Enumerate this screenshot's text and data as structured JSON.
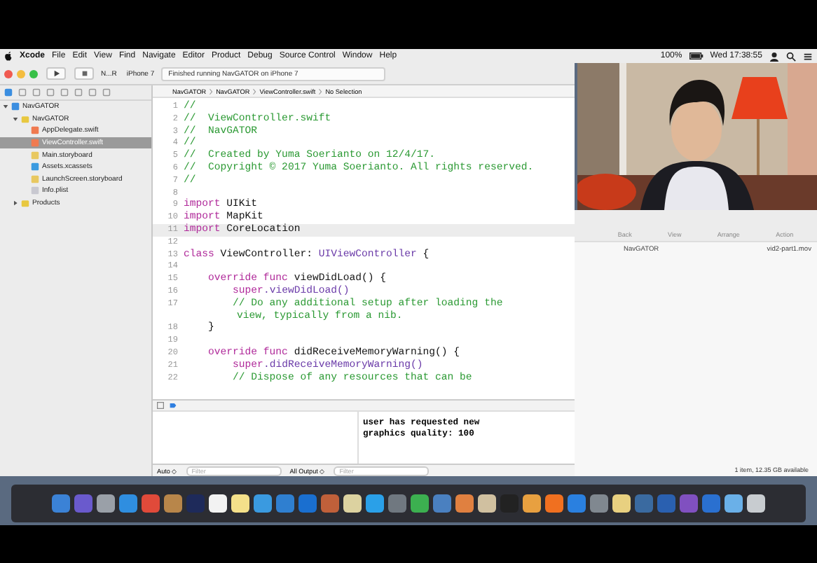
{
  "menu_bar": {
    "menus": [
      "Xcode",
      "File",
      "Edit",
      "View",
      "Find",
      "Navigate",
      "Editor",
      "Product",
      "Debug",
      "Source Control",
      "Window",
      "Help"
    ],
    "battery": "100%",
    "clock": "Wed 17:38:55"
  },
  "xcode": {
    "toolbar": {
      "scheme": "N...R",
      "device": "iPhone 7",
      "status": "Finished running NavGATOR on iPhone 7"
    },
    "navigator": [
      {
        "label": "NavGATOR",
        "kind": "project",
        "expanded": true,
        "selected": false,
        "children": [
          {
            "label": "NavGATOR",
            "kind": "folder",
            "expanded": true,
            "selected": false,
            "children": [
              {
                "label": "AppDelegate.swift",
                "kind": "swift",
                "selected": false
              },
              {
                "label": "ViewController.swift",
                "kind": "swift",
                "selected": true
              },
              {
                "label": "Main.storyboard",
                "kind": "storyboard",
                "selected": false
              },
              {
                "label": "Assets.xcassets",
                "kind": "assets",
                "selected": false
              },
              {
                "label": "LaunchScreen.storyboard",
                "kind": "storyboard",
                "selected": false
              },
              {
                "label": "Info.plist",
                "kind": "plist",
                "selected": false
              }
            ]
          },
          {
            "label": "Products",
            "kind": "folder",
            "expanded": false,
            "selected": false
          }
        ]
      }
    ],
    "jump_bar": [
      "NavGATOR",
      "NavGATOR",
      "ViewController.swift",
      "No Selection"
    ],
    "code": [
      {
        "number": "1",
        "current": false,
        "segments": [
          {
            "kind": "comment",
            "text": "//"
          }
        ]
      },
      {
        "number": "2",
        "current": false,
        "segments": [
          {
            "kind": "comment",
            "text": "//  ViewController.swift"
          }
        ]
      },
      {
        "number": "3",
        "current": false,
        "segments": [
          {
            "kind": "comment",
            "text": "//  NavGATOR"
          }
        ]
      },
      {
        "number": "4",
        "current": false,
        "segments": [
          {
            "kind": "comment",
            "text": "//"
          }
        ]
      },
      {
        "number": "5",
        "current": false,
        "segments": [
          {
            "kind": "comment",
            "text": "//  Created by Yuma Soerianto on 12/4/17."
          }
        ]
      },
      {
        "number": "6",
        "current": false,
        "segments": [
          {
            "kind": "comment",
            "text": "//  Copyright © 2017 Yuma Soerianto. All rights reserved."
          }
        ]
      },
      {
        "number": "7",
        "current": false,
        "segments": [
          {
            "kind": "comment",
            "text": "//"
          }
        ]
      },
      {
        "number": "8",
        "current": false
      },
      {
        "number": "9",
        "current": false,
        "segments": [
          {
            "kind": "keyword",
            "text": "import"
          },
          {
            "kind": "plain",
            "text": " UIKit"
          }
        ]
      },
      {
        "number": "10",
        "current": false,
        "segments": [
          {
            "kind": "keyword",
            "text": "import"
          },
          {
            "kind": "plain",
            "text": " MapKit"
          }
        ]
      },
      {
        "number": "11",
        "current": true,
        "segments": [
          {
            "kind": "keyword",
            "text": "import"
          },
          {
            "kind": "plain",
            "text": " CoreLocation"
          }
        ]
      },
      {
        "number": "12",
        "current": false
      },
      {
        "number": "13",
        "current": false,
        "segments": [
          {
            "kind": "keyword",
            "text": "class"
          },
          {
            "kind": "plain",
            "text": " ViewController: "
          },
          {
            "kind": "type",
            "text": "UIViewController"
          },
          {
            "kind": "plain",
            "text": " {"
          }
        ]
      },
      {
        "number": "14",
        "current": false
      },
      {
        "number": "15",
        "current": false,
        "segments": [
          {
            "kind": "keyword",
            "text": "    override func"
          },
          {
            "kind": "plain",
            "text": " viewDidLoad() {"
          }
        ]
      },
      {
        "number": "16",
        "current": false,
        "segments": [
          {
            "kind": "keyword",
            "text": "        super"
          },
          {
            "kind": "type",
            "text": ".viewDidLoad()"
          }
        ]
      },
      {
        "number": "17",
        "current": false,
        "segments": [
          {
            "kind": "comment",
            "text": "        // Do any additional setup after loading the"
          }
        ],
        "continuation": "view, typically from a nib."
      },
      {
        "number": "18",
        "current": false,
        "segments": [
          {
            "kind": "plain",
            "text": "    }"
          }
        ]
      },
      {
        "number": "19",
        "current": false
      },
      {
        "number": "20",
        "current": false,
        "segments": [
          {
            "kind": "keyword",
            "text": "    override func"
          },
          {
            "kind": "plain",
            "text": " didReceiveMemoryWarning() {"
          }
        ]
      },
      {
        "number": "21",
        "current": false,
        "segments": [
          {
            "kind": "keyword",
            "text": "        super"
          },
          {
            "kind": "type",
            "text": ".didReceiveMemoryWarning()"
          }
        ]
      },
      {
        "number": "22",
        "current": false,
        "segments": [
          {
            "kind": "comment",
            "text": "        // Dispose of any resources that can be"
          }
        ]
      }
    ],
    "console": [
      "user has requested new",
      "graphics quality: 100"
    ],
    "debug_bar": {
      "variables_scope": "Auto ◇",
      "variables_filter": "Filter",
      "output_scope": "All Output ◇",
      "output_filter": "Filter"
    }
  },
  "finder": {
    "toolbar": [
      "Back",
      "View",
      "Arrange",
      "Action"
    ],
    "path": "NavGATOR",
    "file": "vid2-part1.mov",
    "status": "1 item, 12.35 GB available"
  },
  "dock": [
    {
      "color": "#3b82d6"
    },
    {
      "color": "#6a5acd"
    },
    {
      "color": "#9aa0a8"
    },
    {
      "color": "#2f8ee0"
    },
    {
      "color": "#e04a3a"
    },
    {
      "color": "#b8864a"
    },
    {
      "color": "#1e2a5a"
    },
    {
      "color": "#f2f2f2"
    },
    {
      "color": "#f4e08a"
    },
    {
      "color": "#3a9ae0"
    },
    {
      "color": "#2f7fd0"
    },
    {
      "color": "#1a6fd0"
    },
    {
      "color": "#c0603a"
    },
    {
      "color": "#dcd2a0"
    },
    {
      "color": "#2aa0e8"
    },
    {
      "color": "#707880"
    },
    {
      "color": "#3cb050"
    },
    {
      "color": "#4a80c0"
    },
    {
      "color": "#e08040"
    },
    {
      "color": "#d0c0a0"
    },
    {
      "color": "#222222"
    },
    {
      "color": "#e8a040"
    },
    {
      "color": "#f07020"
    },
    {
      "color": "#2a80e0"
    },
    {
      "color": "#808890"
    },
    {
      "color": "#e8d080"
    },
    {
      "color": "#3a6aa0"
    },
    {
      "color": "#2a60b0"
    },
    {
      "color": "#8050c0"
    },
    {
      "color": "#2a70d0"
    },
    {
      "color": "#6ab0e8"
    },
    {
      "color": "#c8ccd0"
    }
  ]
}
